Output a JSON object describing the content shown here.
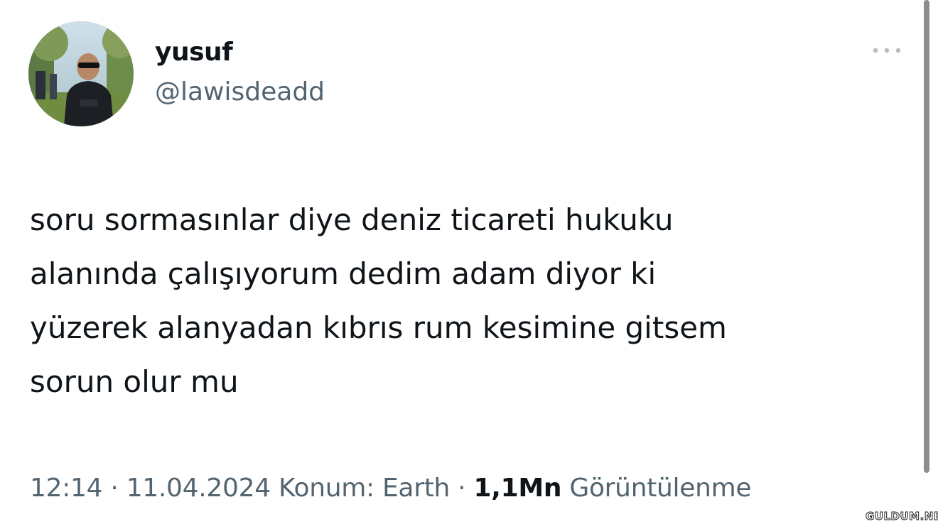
{
  "tweet": {
    "author": {
      "display_name": "yusuf",
      "handle": "@lawisdeadd"
    },
    "menu_icon": "more-horizontal-icon",
    "text_lines": [
      "soru sormasınlar diye deniz ticareti hukuku",
      "alanında çalışıyorum dedim adam diyor ki",
      "yüzerek alanyadan kıbrıs rum kesimine gitsem",
      "sorun olur mu"
    ],
    "meta": {
      "time": "12:14",
      "separator": " · ",
      "date": "11.04.2024",
      "location": "Konum: Earth",
      "views_count": "1,1Mn",
      "views_label": "Görüntülenme"
    }
  },
  "watermark": {
    "text": "GULDUM.NET"
  },
  "colors": {
    "text_primary": "#0f1419",
    "text_secondary": "#536471",
    "background": "#ffffff",
    "scrollbar": "#8a8d91"
  }
}
